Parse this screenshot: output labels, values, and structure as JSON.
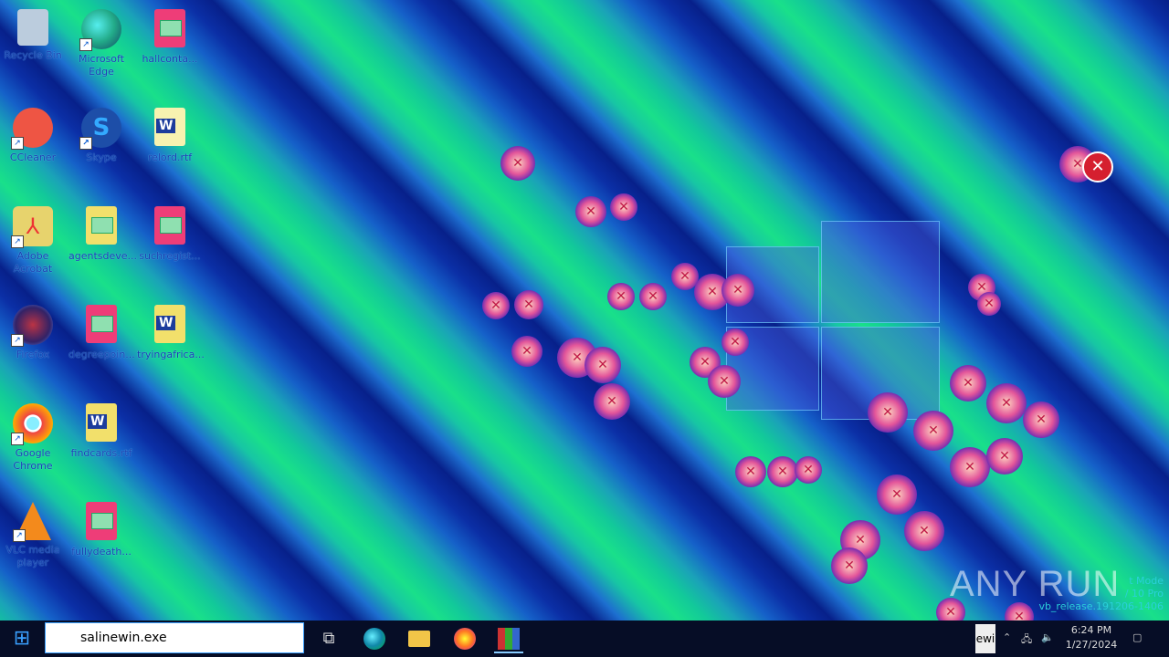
{
  "desktop_icons": [
    {
      "label": "Recycle Bin",
      "icon": "recycle-bin-icon"
    },
    {
      "label": "Microsoft Edge",
      "icon": "edge-icon"
    },
    {
      "label": "hallconta...",
      "icon": "image-file-icon"
    },
    {
      "label": "CCleaner",
      "icon": "ccleaner-icon"
    },
    {
      "label": "Skype",
      "icon": "skype-icon"
    },
    {
      "label": "relord.rtf",
      "icon": "word-doc-icon"
    },
    {
      "label": "Adobe Acrobat",
      "icon": "acrobat-icon"
    },
    {
      "label": "agentsdeve...",
      "icon": "image-file-icon"
    },
    {
      "label": "suchregist...",
      "icon": "image-file-icon"
    },
    {
      "label": "Firefox",
      "icon": "firefox-icon"
    },
    {
      "label": "degreepoin...",
      "icon": "image-file-icon"
    },
    {
      "label": "tryingafrica...",
      "icon": "word-doc-icon"
    },
    {
      "label": "Google Chrome",
      "icon": "chrome-icon"
    },
    {
      "label": "findcards.rtf",
      "icon": "word-doc-icon"
    },
    {
      "label": "VLC media player",
      "icon": "vlc-icon"
    },
    {
      "label": "fullydeath...",
      "icon": "image-file-icon"
    }
  ],
  "watermark": "ANY RUN",
  "windows_overlay": {
    "line1": "t Mode",
    "line2": "/ 10 Pro",
    "line3": "vb_release.191206-1406"
  },
  "taskbar": {
    "search_value": "salinewin.exe",
    "pinned": [
      "task-view-icon",
      "edge-icon",
      "file-explorer-icon",
      "firefox-icon",
      "winrar-icon"
    ],
    "tray_text": "ewi",
    "clock_time": "6:24 PM",
    "clock_date": "1/27/2024"
  }
}
